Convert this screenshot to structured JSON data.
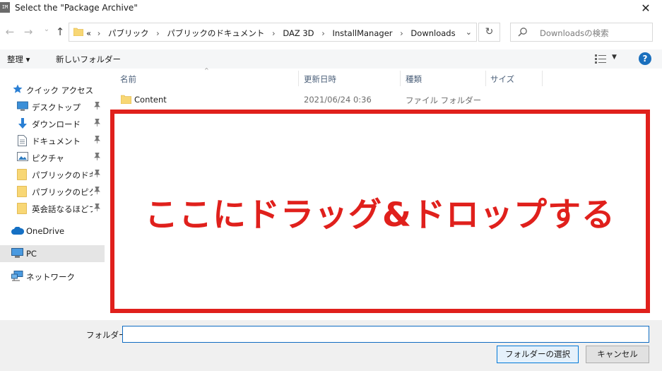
{
  "window": {
    "title": "Select the \"Package Archive\"",
    "app_icon_text": "IM",
    "close_glyph": "✕"
  },
  "nav": {
    "back_glyph": "←",
    "forward_glyph": "→",
    "recent_glyph": "⌄",
    "up_glyph": "↑",
    "address_prefix": "«",
    "breadcrumb": [
      "パブリック",
      "パブリックのドキュメント",
      "DAZ 3D",
      "InstallManager",
      "Downloads"
    ],
    "breadcrumb_sep": "›",
    "address_dropdown": "⌄",
    "refresh_glyph": "↻",
    "search_placeholder": "Downloadsの検索"
  },
  "toolbar": {
    "organize": "整理 ▾",
    "new_folder": "新しいフォルダー",
    "view_dd": "▼",
    "help": "?"
  },
  "sidebar": {
    "quick_access": "クイック アクセス",
    "items": [
      {
        "label": "デスクトップ",
        "icon": "desktop-icon"
      },
      {
        "label": "ダウンロード",
        "icon": "download-icon"
      },
      {
        "label": "ドキュメント",
        "icon": "document-icon"
      },
      {
        "label": "ピクチャ",
        "icon": "pictures-icon"
      },
      {
        "label": "パブリックのドキュメ",
        "icon": "folder-icon"
      },
      {
        "label": "パブリックのピクチャ",
        "icon": "folder-icon"
      },
      {
        "label": "英会話なるほどフレ",
        "icon": "folder-icon"
      }
    ],
    "pin_glyph": "📌",
    "onedrive": "OneDrive",
    "pc": "PC",
    "network": "ネットワーク"
  },
  "columns": {
    "name": "名前",
    "date": "更新日時",
    "type": "種類",
    "size": "サイズ",
    "sort_glyph": "^"
  },
  "rows": [
    {
      "name": "Content",
      "date": "2021/06/24 0:36",
      "type": "ファイル フォルダー",
      "size": ""
    }
  ],
  "overlay": {
    "text": "ここにドラッグ&ドロップする",
    "color": "#e0201c"
  },
  "bottom": {
    "folder_label": "フォルダー:",
    "folder_value": "",
    "select_button": "フォルダーの選択",
    "cancel_button": "キャンセル"
  },
  "colors": {
    "accent": "#0078d7",
    "help": "#1a6fbd",
    "selected_bg": "#e5e5e5"
  }
}
